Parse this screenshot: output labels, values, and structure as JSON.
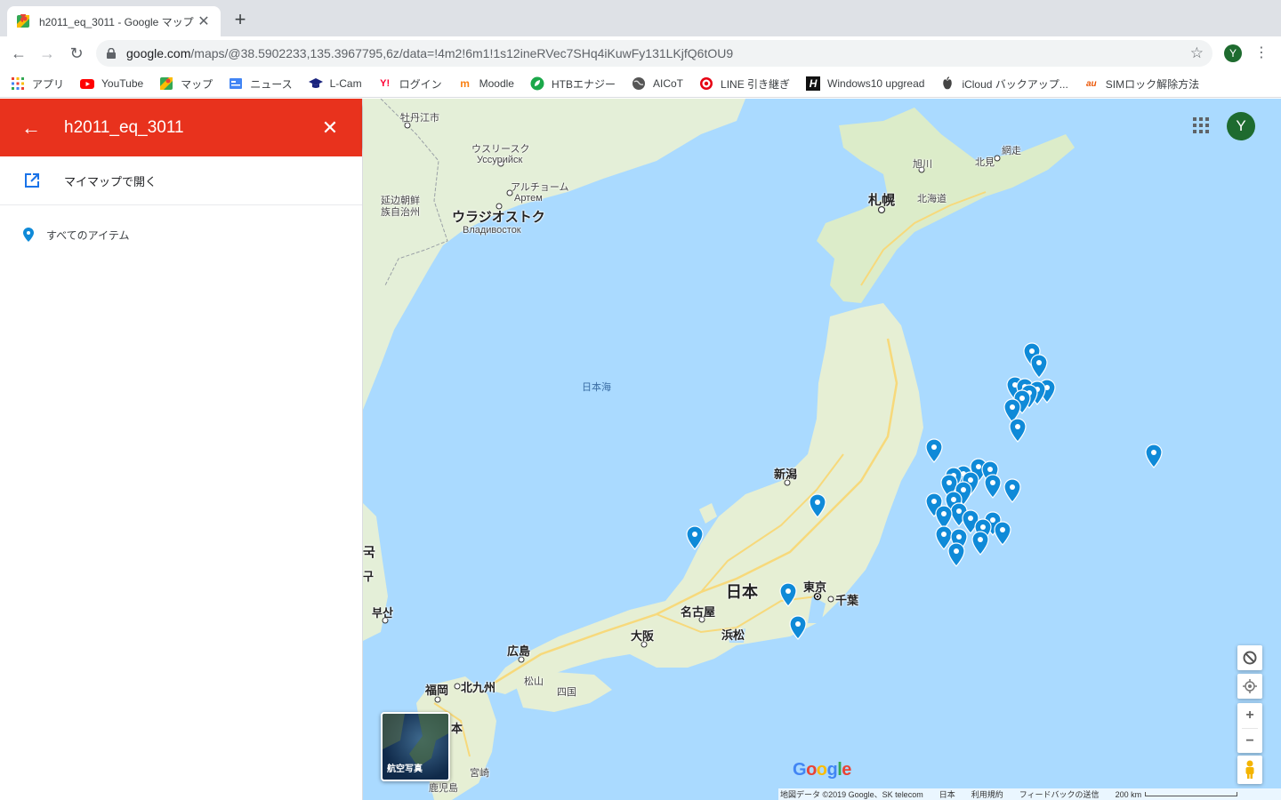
{
  "browser": {
    "tab_title": "h2011_eq_3011 - Google マップ",
    "url_host": "google.com",
    "url_path": "/maps/@38.5902233,135.3967795,6z/data=!4m2!6m1!1s12ineRVec7SHq4iKuwFy131LKjfQ6tOU9",
    "profile_initial": "Y",
    "bookmarks": [
      {
        "label": "アプリ",
        "icon": "apps-grid-icon"
      },
      {
        "label": "YouTube",
        "icon": "youtube-icon"
      },
      {
        "label": "マップ",
        "icon": "maps-icon"
      },
      {
        "label": "ニュース",
        "icon": "news-icon"
      },
      {
        "label": "L-Cam",
        "icon": "graduation-cap-icon"
      },
      {
        "label": "ログイン",
        "icon": "yahoo-icon"
      },
      {
        "label": "Moodle",
        "icon": "moodle-icon"
      },
      {
        "label": "HTBエナジー",
        "icon": "leaf-icon"
      },
      {
        "label": "AICoT",
        "icon": "globe-icon"
      },
      {
        "label": "LINE 引き継ぎ",
        "icon": "target-icon"
      },
      {
        "label": "Windows10 upgread",
        "icon": "h-icon"
      },
      {
        "label": "iCloud バックアップ...",
        "icon": "apple-icon"
      },
      {
        "label": "SIMロック解除方法",
        "icon": "au-icon"
      }
    ]
  },
  "sidebar": {
    "title": "h2011_eq_3011",
    "open_in_mymaps": "マイマップで開く",
    "all_items": "すべてのアイテム"
  },
  "map": {
    "avatar_initial": "Y",
    "satellite_label": "航空写真",
    "google_logo": "Google",
    "labels": {
      "mudanjiang": "牡丹江市",
      "ussuriysk_ja": "ウスリースク",
      "ussuriysk_ru": "Уссурийск",
      "artyom_ja": "アルチョーム",
      "artyom_ru": "Артем",
      "yanbian1": "延边朝鲜",
      "yanbian2": "族自治州",
      "vladivostok_ja": "ウラジオストク",
      "vladivostok_ru": "Владивосток",
      "sea_of_japan": "日本海",
      "abashiri": "網走",
      "kitami": "北見",
      "asahikawa": "旭川",
      "sapporo": "札幌",
      "hokkaido": "北海道",
      "niigata": "新潟",
      "japan": "日本",
      "tokyo": "東京",
      "chiba": "千葉",
      "nagoya": "名古屋",
      "hamamatsu": "浜松",
      "osaka": "大阪",
      "hiroshima": "広島",
      "matsuyama": "松山",
      "shikoku": "四国",
      "fukuoka": "福岡",
      "kitakyushu": "北九州",
      "miyazaki": "宮崎",
      "kagoshima": "鹿児島",
      "busan": "부산",
      "korea_edge1": "국",
      "korea_edge2": "구",
      "kyushu_edge": "本"
    },
    "attribution": {
      "data": "地図データ ©2019 Google、SK telecom",
      "region": "日本",
      "terms": "利用規約",
      "feedback": "フィードバックの送信",
      "scale": "200 km"
    },
    "marker_color": "#0f8ad8",
    "markers": [
      {
        "lat": 40.2,
        "lon": 143.9
      },
      {
        "lat": 39.95,
        "lon": 144.05
      },
      {
        "lat": 39.48,
        "lon": 143.55
      },
      {
        "lat": 39.45,
        "lon": 143.75
      },
      {
        "lat": 39.42,
        "lon": 144.2
      },
      {
        "lat": 39.38,
        "lon": 144.0
      },
      {
        "lat": 39.3,
        "lon": 143.85
      },
      {
        "lat": 39.2,
        "lon": 143.7
      },
      {
        "lat": 39.0,
        "lon": 143.5
      },
      {
        "lat": 38.6,
        "lon": 143.6
      },
      {
        "lat": 38.15,
        "lon": 141.9
      },
      {
        "lat": 38.05,
        "lon": 146.4
      },
      {
        "lat": 37.75,
        "lon": 142.8
      },
      {
        "lat": 37.68,
        "lon": 143.05
      },
      {
        "lat": 37.6,
        "lon": 142.5
      },
      {
        "lat": 37.55,
        "lon": 142.3
      },
      {
        "lat": 37.45,
        "lon": 142.65
      },
      {
        "lat": 37.4,
        "lon": 143.1
      },
      {
        "lat": 37.4,
        "lon": 142.2
      },
      {
        "lat": 37.3,
        "lon": 143.5
      },
      {
        "lat": 37.25,
        "lon": 142.5
      },
      {
        "lat": 37.05,
        "lon": 142.3
      },
      {
        "lat": 37.0,
        "lon": 141.9
      },
      {
        "lat": 36.98,
        "lon": 139.5
      },
      {
        "lat": 36.8,
        "lon": 142.4
      },
      {
        "lat": 36.75,
        "lon": 142.1
      },
      {
        "lat": 36.65,
        "lon": 142.65
      },
      {
        "lat": 36.6,
        "lon": 143.1
      },
      {
        "lat": 36.45,
        "lon": 142.9
      },
      {
        "lat": 36.4,
        "lon": 143.3
      },
      {
        "lat": 36.3,
        "lon": 142.1
      },
      {
        "lat": 36.25,
        "lon": 142.4
      },
      {
        "lat": 36.2,
        "lon": 142.85
      },
      {
        "lat": 35.95,
        "lon": 142.35
      },
      {
        "lat": 36.3,
        "lon": 137.0
      },
      {
        "lat": 35.1,
        "lon": 138.9
      },
      {
        "lat": 34.4,
        "lon": 139.1
      }
    ]
  }
}
